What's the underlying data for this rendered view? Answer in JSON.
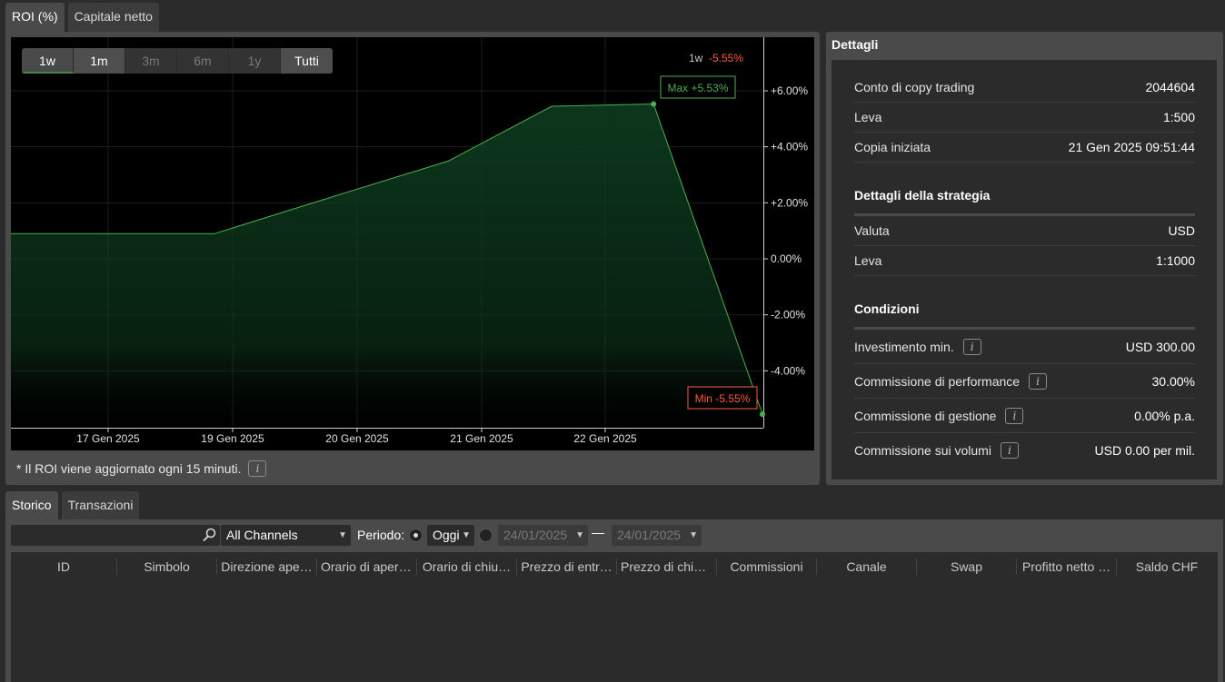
{
  "top_tabs": [
    {
      "label": "ROI (%)",
      "active": true
    },
    {
      "label": "Capitale netto",
      "active": false
    }
  ],
  "range_buttons": [
    {
      "label": "1w",
      "state": "selected"
    },
    {
      "label": "1m",
      "state": "enabled"
    },
    {
      "label": "3m",
      "state": "disabled"
    },
    {
      "label": "6m",
      "state": "disabled"
    },
    {
      "label": "1y",
      "state": "disabled"
    },
    {
      "label": "Tutti",
      "state": "enabled"
    }
  ],
  "chart_data": {
    "type": "area",
    "period_label": "1w",
    "period_value": "-5.55%",
    "x": [
      "2025-01-16",
      "2025-01-18",
      "2025-01-19",
      "2025-01-20",
      "2025-01-21",
      "2025-01-22",
      "2025-01-23",
      "2025-01-24"
    ],
    "values": [
      0.9,
      0.9,
      2.3,
      3.5,
      5.45,
      5.53,
      -5.55
    ],
    "x_points": [
      0.0,
      1.72,
      2.78,
      3.7,
      4.57,
      5.43,
      6.35
    ],
    "series": [
      {
        "values": [
          0.9,
          0.9,
          2.3,
          3.5,
          5.45,
          5.53,
          -5.55
        ]
      }
    ],
    "x_tick_labels": [
      "17 Gen 2025",
      "19 Gen 2025",
      "20 Gen 2025",
      "21 Gen 2025",
      "22 Gen 2025"
    ],
    "y_tick_labels": [
      "+6.00%",
      "+4.00%",
      "+2.00%",
      "0.00%",
      "-2.00%",
      "-4.00%"
    ],
    "y_ticks": [
      6,
      4,
      2,
      0,
      -2,
      -4
    ],
    "ylim": [
      -6,
      8
    ],
    "max_label": "Max +5.53%",
    "min_label": "Min -5.55%",
    "grid": true,
    "line_color": "#4caf50",
    "fill_color": "#0d3a1e",
    "max_color": "#4caf50",
    "min_color": "#ff5a3c"
  },
  "roi_note": "* Il ROI viene aggiornato ogni 15 minuti.",
  "details": {
    "title": "Dettagli",
    "account": [
      {
        "label": "Conto di copy trading",
        "value": "2044604"
      },
      {
        "label": "Leva",
        "value": "1:500"
      },
      {
        "label": "Copia iniziata",
        "value": "21 Gen 2025 09:51:44"
      }
    ],
    "strategy_title": "Dettagli della strategia",
    "strategy": [
      {
        "label": "Valuta",
        "value": "USD"
      },
      {
        "label": "Leva",
        "value": "1:1000"
      }
    ],
    "conditions_title": "Condizioni",
    "conditions": [
      {
        "label": "Investimento min.",
        "value": "USD 300.00"
      },
      {
        "label": "Commissione di performance",
        "value": "30.00%"
      },
      {
        "label": "Commissione di gestione",
        "value": "0.00% p.a."
      },
      {
        "label": "Commissione sui volumi",
        "value": "USD 0.00 per mil."
      }
    ]
  },
  "bottom_tabs": [
    {
      "label": "Storico",
      "active": true
    },
    {
      "label": "Transazioni",
      "active": false
    }
  ],
  "filters": {
    "search_value": "",
    "channel": "All Channels",
    "periodo_label": "Periodo:",
    "period_select": "Oggi",
    "date_from": "24/01/2025",
    "date_to": "24/01/2025",
    "dash": "—"
  },
  "columns": [
    "ID",
    "Simbolo",
    "Direzione ape…",
    "Orario di apert…",
    "Orario di chiu…",
    "Prezzo di entr…",
    "Prezzo di chiu…",
    "Commissioni",
    "Canale",
    "Swap",
    "Profitto netto …",
    "Saldo CHF"
  ]
}
